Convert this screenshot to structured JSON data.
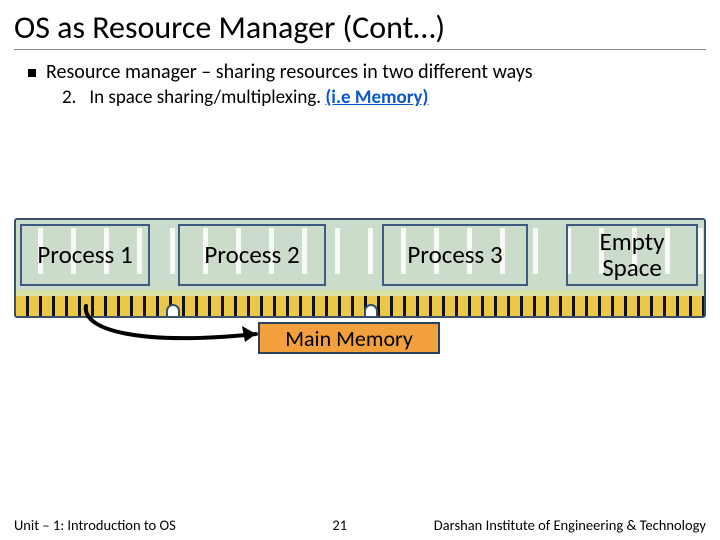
{
  "title": "OS as Resource Manager (Cont…)",
  "bullets": {
    "l1": "Resource manager – sharing resources in two different ways",
    "l2_num": "2.",
    "l2_text": "In space sharing/multiplexing.",
    "l2_link": "(i.e Memory)"
  },
  "segments": {
    "p1": "Process 1",
    "p2": "Process 2",
    "p3": "Process 3",
    "p4": "Empty Space"
  },
  "main_memory_label": "Main Memory",
  "footer": {
    "unit": "Unit – 1: Introduction to OS",
    "page": "21",
    "institute": "Darshan Institute of Engineering & Technology"
  }
}
